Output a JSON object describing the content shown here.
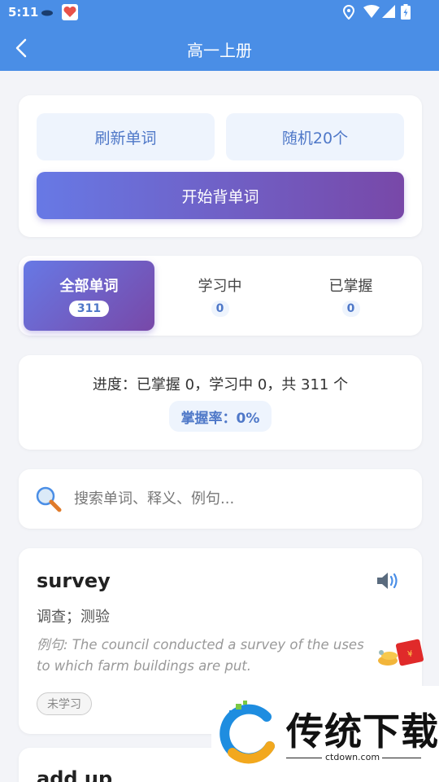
{
  "status_bar": {
    "time": "5:11"
  },
  "app_bar": {
    "title": "高一上册"
  },
  "actions": {
    "refresh_label": "刷新单词",
    "random_label": "随机20个",
    "start_label": "开始背单词"
  },
  "tabs": [
    {
      "label": "全部单词",
      "count": "311"
    },
    {
      "label": "学习中",
      "count": "0"
    },
    {
      "label": "已掌握",
      "count": "0"
    }
  ],
  "progress": {
    "text": "进度：已掌握 0，学习中 0，共 311 个",
    "rate": "掌握率：0%"
  },
  "search": {
    "placeholder": "搜索单词、释义、例句..."
  },
  "words": [
    {
      "word": "survey",
      "meaning": "调查；测验",
      "example": "例句: The council conducted a survey of the uses to which farm buildings are put.",
      "status": "未学习"
    },
    {
      "word": "add up"
    }
  ],
  "watermark": {
    "brand": "传统下载",
    "url": "ctdown.com"
  },
  "colors": {
    "primary": "#4a8ee6",
    "gradient_start": "#6779e5",
    "gradient_end": "#7848a8",
    "chip_bg": "#eef4fd",
    "chip_text": "#4f78c8"
  }
}
